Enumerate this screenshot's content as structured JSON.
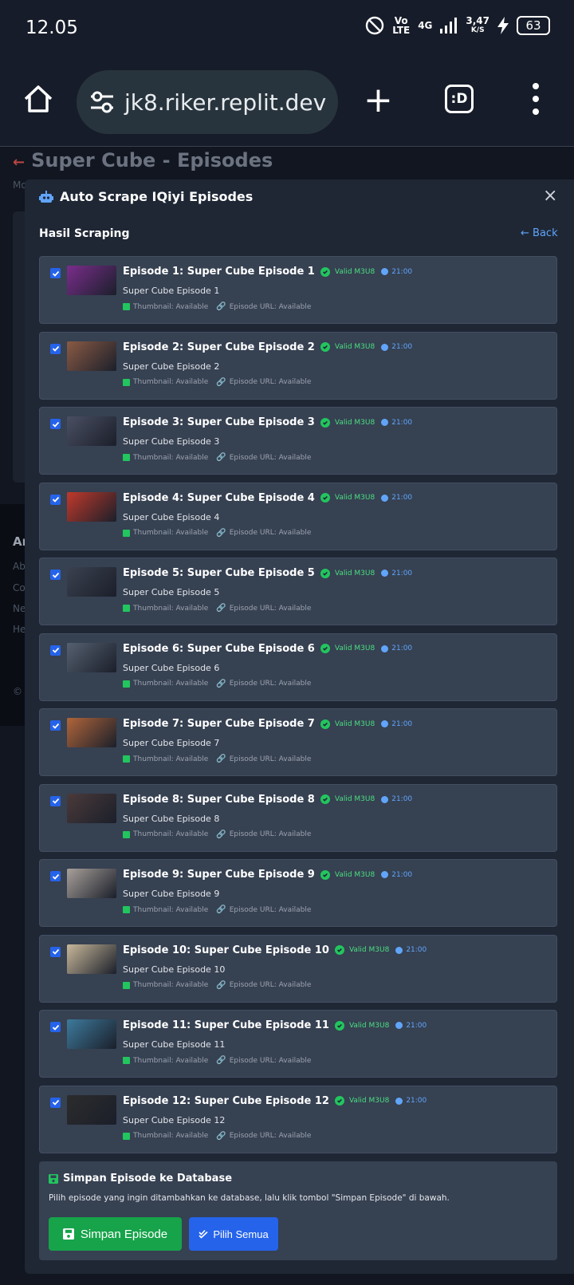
{
  "status_bar": {
    "time": "12.05",
    "network": "4G",
    "volte": "Vo LTE",
    "speed_value": "3,47",
    "speed_unit": "K/S",
    "battery": "63"
  },
  "browser": {
    "url": "jk8.riker.replit.dev",
    "tabs_label": ":D"
  },
  "background_page": {
    "title": "Super Cube - Episodes",
    "subtitle": "Mo",
    "footer_heading": "Ar",
    "footer_links": [
      "Ab",
      "Co",
      "Ne",
      "He"
    ],
    "footer_copyright": "© 2"
  },
  "modal": {
    "title": "Auto Scrape IQiyi Episodes",
    "close_label": "×",
    "results_label": "Hasil Scraping",
    "back_label": "Back"
  },
  "episodes": [
    {
      "title": "Episode 1: Super Cube Episode 1",
      "subtitle": "Super Cube Episode 1",
      "thumb_color": "#7a2d8c"
    },
    {
      "title": "Episode 2: Super Cube Episode 2",
      "subtitle": "Super Cube Episode 2",
      "thumb_color": "#8a5a44"
    },
    {
      "title": "Episode 3: Super Cube Episode 3",
      "subtitle": "Super Cube Episode 3",
      "thumb_color": "#4a4f63"
    },
    {
      "title": "Episode 4: Super Cube Episode 4",
      "subtitle": "Super Cube Episode 4",
      "thumb_color": "#c0392b"
    },
    {
      "title": "Episode 5: Super Cube Episode 5",
      "subtitle": "Super Cube Episode 5",
      "thumb_color": "#3b4150"
    },
    {
      "title": "Episode 6: Super Cube Episode 6",
      "subtitle": "Super Cube Episode 6",
      "thumb_color": "#556070"
    },
    {
      "title": "Episode 7: Super Cube Episode 7",
      "subtitle": "Super Cube Episode 7",
      "thumb_color": "#b0653a"
    },
    {
      "title": "Episode 8: Super Cube Episode 8",
      "subtitle": "Super Cube Episode 8",
      "thumb_color": "#4a3a3a"
    },
    {
      "title": "Episode 9: Super Cube Episode 9",
      "subtitle": "Super Cube Episode 9",
      "thumb_color": "#a8a09a"
    },
    {
      "title": "Episode 10: Super Cube Episode 10",
      "subtitle": "Super Cube Episode 10",
      "thumb_color": "#c8b89a"
    },
    {
      "title": "Episode 11: Super Cube Episode 11",
      "subtitle": "Super Cube Episode 11",
      "thumb_color": "#3d7a9c"
    },
    {
      "title": "Episode 12: Super Cube Episode 12",
      "subtitle": "Super Cube Episode 12",
      "thumb_color": "#2c2c2c"
    }
  ],
  "episode_labels": {
    "valid": "Valid M3U8",
    "duration": "21:00",
    "thumbnail": "Thumbnail: Available",
    "episode_url": "Episode URL: Available"
  },
  "save_panel": {
    "title": "Simpan Episode ke Database",
    "description": "Pilih episode yang ingin ditambahkan ke database, lalu klik tombol \"Simpan Episode\" di bawah.",
    "save_button": "Simpan Episode",
    "select_all_button": "Pilih Semua"
  },
  "colors": {
    "accent_blue": "#2563eb",
    "success_green": "#16a34a",
    "card_bg": "#364152",
    "modal_bg": "#1f2735"
  }
}
